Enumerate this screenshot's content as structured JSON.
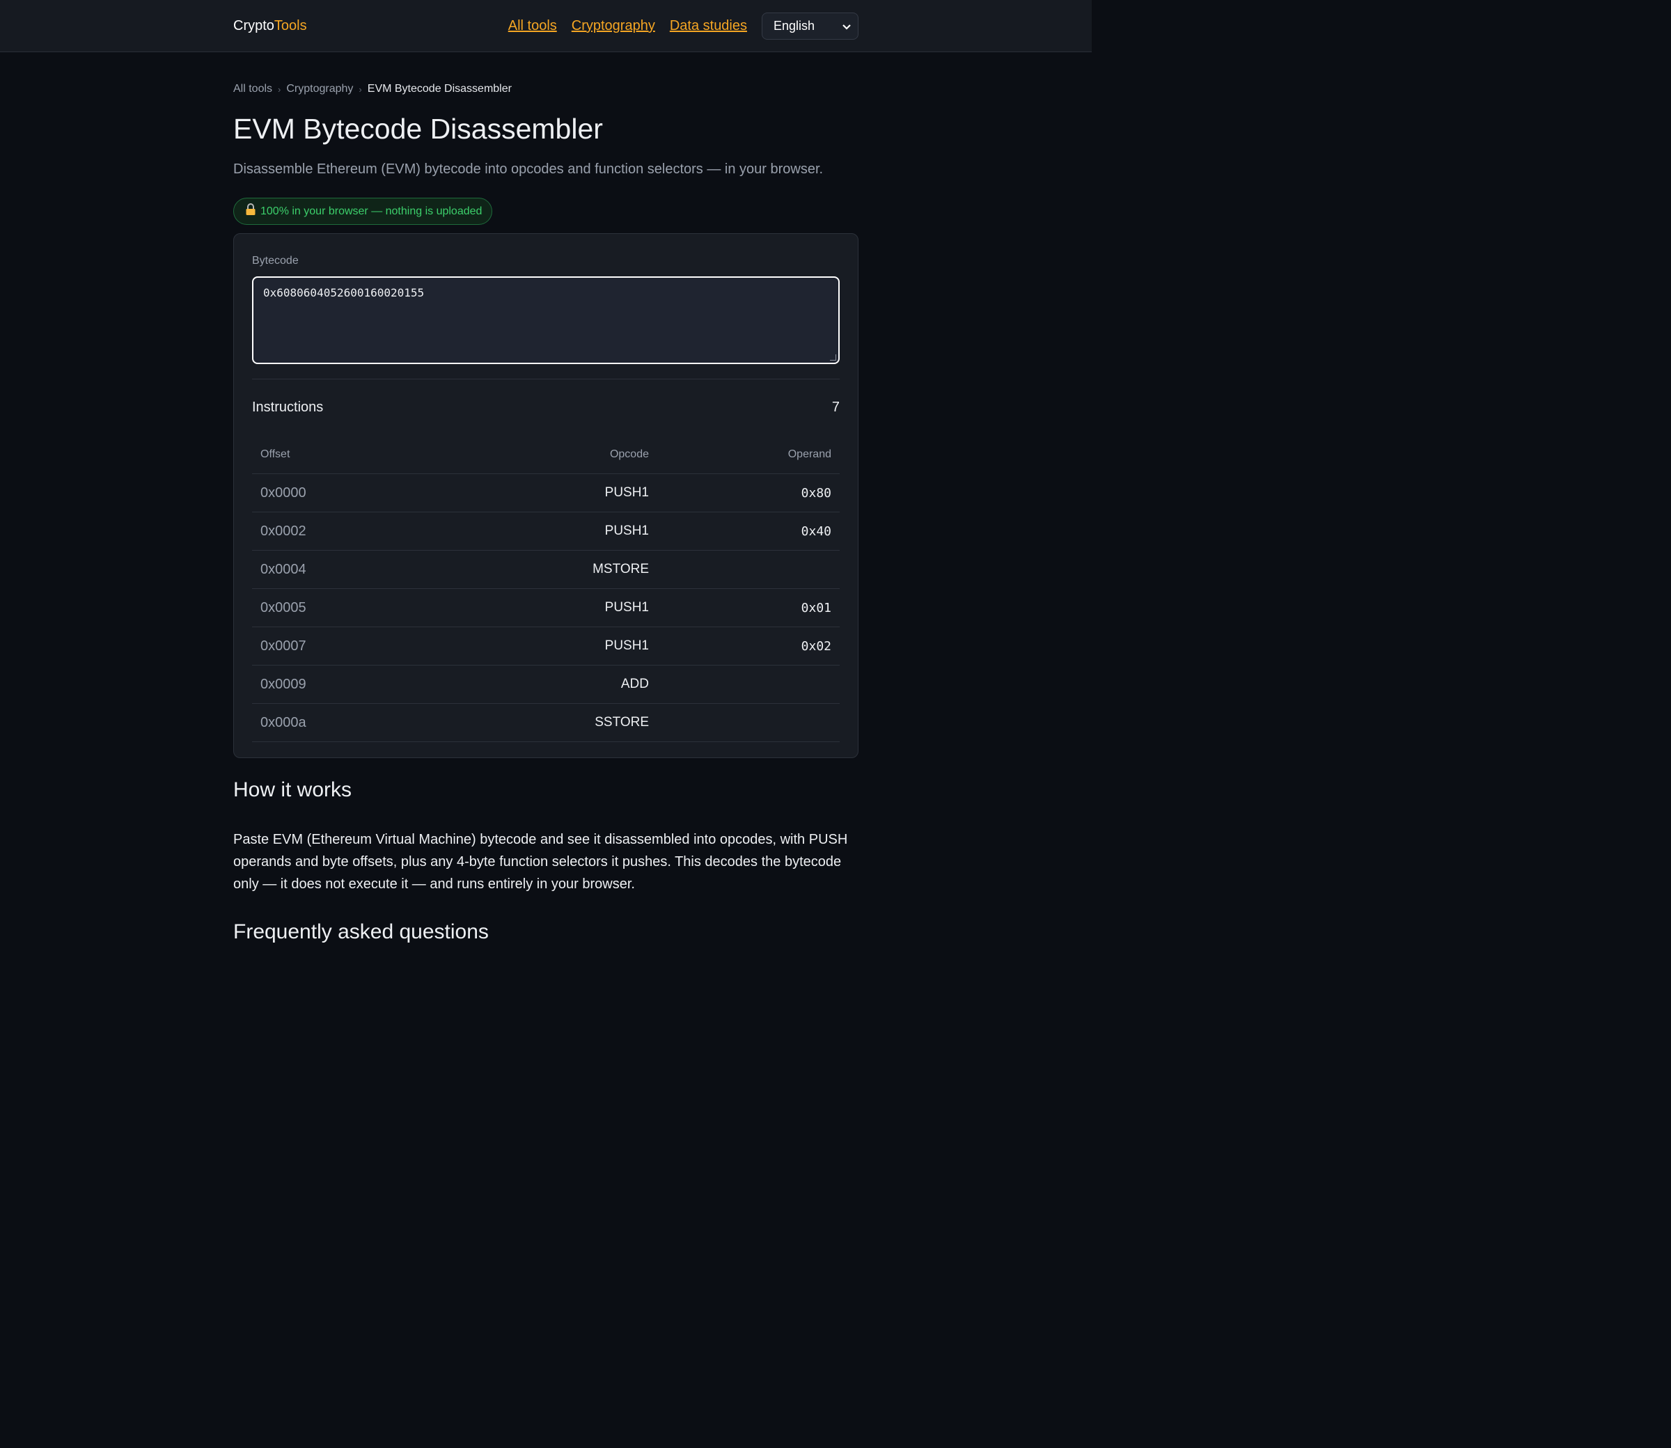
{
  "header": {
    "brand_main": "Crypto",
    "brand_accent": "Tools",
    "nav": [
      "All tools",
      "Cryptography",
      "Data studies"
    ],
    "language": "English"
  },
  "breadcrumb": [
    "All tools",
    "Cryptography",
    "EVM Bytecode Disassembler"
  ],
  "page": {
    "title": "EVM Bytecode Disassembler",
    "subtitle": "Disassemble Ethereum (EVM) bytecode into opcodes and function selectors — in your browser.",
    "badge": "100% in your browser — nothing is uploaded"
  },
  "tool": {
    "bytecode_label": "Bytecode",
    "bytecode_value": "0x6080604052600160020155",
    "instructions_label": "Instructions",
    "instructions_count": "7",
    "columns": [
      "Offset",
      "Opcode",
      "Operand"
    ],
    "rows": [
      {
        "offset": "0x0000",
        "opcode": "PUSH1",
        "operand": "0x80"
      },
      {
        "offset": "0x0002",
        "opcode": "PUSH1",
        "operand": "0x40"
      },
      {
        "offset": "0x0004",
        "opcode": "MSTORE",
        "operand": ""
      },
      {
        "offset": "0x0005",
        "opcode": "PUSH1",
        "operand": "0x01"
      },
      {
        "offset": "0x0007",
        "opcode": "PUSH1",
        "operand": "0x02"
      },
      {
        "offset": "0x0009",
        "opcode": "ADD",
        "operand": ""
      },
      {
        "offset": "0x000a",
        "opcode": "SSTORE",
        "operand": ""
      }
    ]
  },
  "how_it_works": {
    "title": "How it works",
    "text": "Paste EVM (Ethereum Virtual Machine) bytecode and see it disassembled into opcodes, with PUSH operands and byte offsets, plus any 4-byte function selectors it pushes. This decodes the bytecode only — it does not execute it — and runs entirely in your browser."
  },
  "faq": {
    "title": "Frequently asked questions"
  },
  "icons": {
    "badge_icon": "lock-icon",
    "language_dropdown": "chevron-down-icon",
    "breadcrumb_separator": "chevron-right-icon"
  }
}
